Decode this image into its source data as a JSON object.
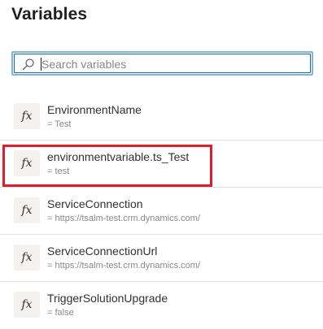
{
  "page": {
    "title": "Variables"
  },
  "search": {
    "placeholder": "Search variables",
    "value": "",
    "icon": "search-icon"
  },
  "variables": [
    {
      "icon": "fx",
      "name": "EnvironmentName",
      "value": "= Test"
    },
    {
      "icon": "fx",
      "name": "environmentvariable.ts_Test",
      "value": "= test"
    },
    {
      "icon": "fx",
      "name": "ServiceConnection",
      "value": "= https://tsalm-test.crm.dynamics.com/"
    },
    {
      "icon": "fx",
      "name": "ServiceConnectionUrl",
      "value": "= https://tsalm-test.crm.dynamics.com/"
    },
    {
      "icon": "fx",
      "name": "TriggerSolutionUpgrade",
      "value": "= false"
    }
  ],
  "annotation": {
    "highlighted_index": 1,
    "color": "#e01d2c"
  },
  "colors": {
    "accent": "#0f6cbd",
    "focus_ring": "#7fb4e6"
  }
}
